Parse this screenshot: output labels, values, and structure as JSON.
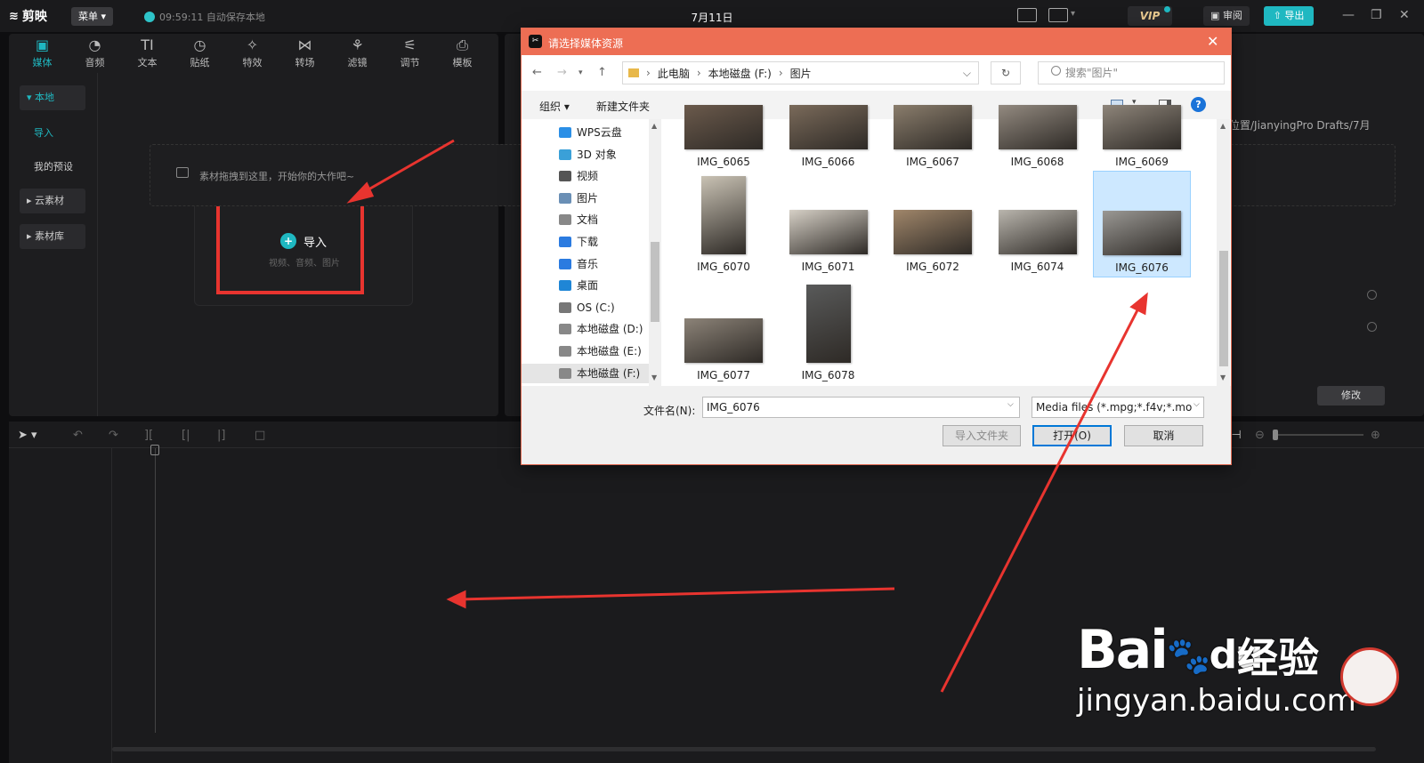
{
  "app": {
    "logo": "剪映",
    "menu_label": "菜单",
    "autosave": "09:59:11 自动保存本地",
    "doc_title": "7月11日",
    "vip_label": "VIP",
    "review_label": "审阅",
    "export_label": "导出"
  },
  "tools": [
    {
      "label": "媒体",
      "icon": "media-icon"
    },
    {
      "label": "音频",
      "icon": "audio-icon"
    },
    {
      "label": "文本",
      "icon": "text-icon"
    },
    {
      "label": "贴纸",
      "icon": "sticker-icon"
    },
    {
      "label": "特效",
      "icon": "effects-icon"
    },
    {
      "label": "转场",
      "icon": "transition-icon"
    },
    {
      "label": "滤镜",
      "icon": "filter-icon"
    },
    {
      "label": "调节",
      "icon": "adjust-icon"
    },
    {
      "label": "模板",
      "icon": "template-icon"
    }
  ],
  "side_nav": {
    "local": "本地",
    "import": "导入",
    "presets": "我的预设",
    "cloud": "云素材",
    "library": "素材库"
  },
  "import_card": {
    "label": "导入",
    "sub": "视频、音频、图片"
  },
  "right_panel": {
    "draft_path": "保留位置/JianyingPro Drafts/7月",
    "edit_label": "修改"
  },
  "timeline": {
    "drop_text": "素材拖拽到这里，开始你的大作吧~"
  },
  "dialog": {
    "title": "请选择媒体资源",
    "breadcrumb": [
      "此电脑",
      "本地磁盘 (F:)",
      "图片"
    ],
    "search_placeholder": "搜索\"图片\"",
    "organize_label": "组织 ▾",
    "new_folder_label": "新建文件夹",
    "tree": [
      {
        "label": "WPS云盘",
        "color": "#2b8fe6"
      },
      {
        "label": "3D 对象",
        "color": "#3aa0d8"
      },
      {
        "label": "视频",
        "color": "#555"
      },
      {
        "label": "图片",
        "color": "#6a8fb5"
      },
      {
        "label": "文档",
        "color": "#888"
      },
      {
        "label": "下载",
        "color": "#2b7be0"
      },
      {
        "label": "音乐",
        "color": "#2b7be0"
      },
      {
        "label": "桌面",
        "color": "#1f86d6"
      },
      {
        "label": "OS (C:)",
        "color": "#777"
      },
      {
        "label": "本地磁盘 (D:)",
        "color": "#888"
      },
      {
        "label": "本地磁盘 (E:)",
        "color": "#888"
      },
      {
        "label": "本地磁盘 (F:)",
        "color": "#888"
      }
    ],
    "files": [
      "IMG_6065",
      "IMG_6066",
      "IMG_6067",
      "IMG_6068",
      "IMG_6069",
      "IMG_6070",
      "IMG_6071",
      "IMG_6072",
      "IMG_6074",
      "IMG_6076",
      "IMG_6077",
      "IMG_6078"
    ],
    "selected_file": "IMG_6076",
    "filename_label": "文件名(N):",
    "filename_value": "IMG_6076",
    "filetype_value": "Media files (*.mpg;*.f4v;*.mo",
    "btn_import_folder": "导入文件夹",
    "btn_open": "打开(O)",
    "btn_cancel": "取消"
  },
  "watermark": {
    "brand": "Bai",
    "brand2": "du",
    "jingyan": "经验",
    "url": "jingyan.baidu.com"
  },
  "colors": {
    "accent": "#1fb8c1",
    "dialog_title": "#ed6e54",
    "annotation_red": "#e8342f"
  }
}
